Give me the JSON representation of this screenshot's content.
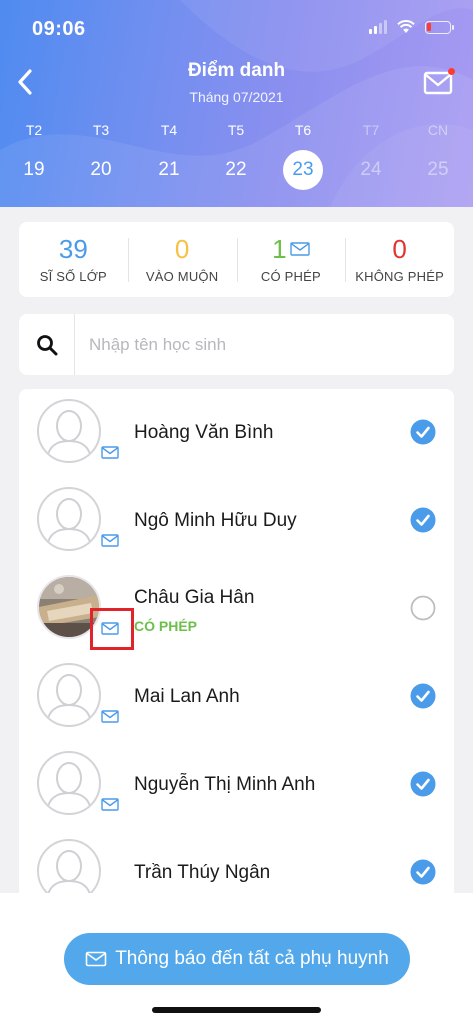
{
  "status_bar": {
    "time": "09:06"
  },
  "header": {
    "title": "Điểm danh",
    "subtitle": "Tháng 07/2021"
  },
  "week": [
    {
      "name": "T2",
      "num": "19",
      "state": "normal"
    },
    {
      "name": "T3",
      "num": "20",
      "state": "normal"
    },
    {
      "name": "T4",
      "num": "21",
      "state": "normal"
    },
    {
      "name": "T5",
      "num": "22",
      "state": "normal"
    },
    {
      "name": "T6",
      "num": "23",
      "state": "selected"
    },
    {
      "name": "T7",
      "num": "24",
      "state": "muted"
    },
    {
      "name": "CN",
      "num": "25",
      "state": "muted"
    }
  ],
  "stats": [
    {
      "value": "39",
      "label": "SĨ SỐ LỚP",
      "color": "#4a9bea"
    },
    {
      "value": "0",
      "label": "VÀO MUỘN",
      "color": "#f5c242"
    },
    {
      "value": "1",
      "label": "CÓ PHÉP",
      "color": "#6cc04a",
      "icon": "mail-icon"
    },
    {
      "value": "0",
      "label": "KHÔNG PHÉP",
      "color": "#e0342c"
    }
  ],
  "search": {
    "placeholder": "Nhập tên học sinh"
  },
  "students": [
    {
      "name": "Hoàng Văn Bình",
      "status": "",
      "checked": true,
      "avatar": "default-avatar"
    },
    {
      "name": "Ngô Minh Hữu Duy",
      "status": "",
      "checked": true,
      "avatar": "default-avatar"
    },
    {
      "name": "Châu Gia Hân",
      "status": "CÓ PHÉP",
      "checked": false,
      "avatar": "photo-avatar"
    },
    {
      "name": "Mai Lan Anh",
      "status": "",
      "checked": true,
      "avatar": "default-avatar"
    },
    {
      "name": "Nguyễn Thị Minh Anh",
      "status": "",
      "checked": true,
      "avatar": "default-avatar"
    },
    {
      "name": "Trần Thúy Ngân",
      "status": "",
      "checked": true,
      "avatar": "default-avatar"
    }
  ],
  "bottom": {
    "notify_label": "Thông báo đến tất cả phụ huynh"
  },
  "colors": {
    "accent": "#52a8ea",
    "check": "#4a9bea",
    "permitted": "#6cc04a",
    "highlight": "#e0242c"
  }
}
